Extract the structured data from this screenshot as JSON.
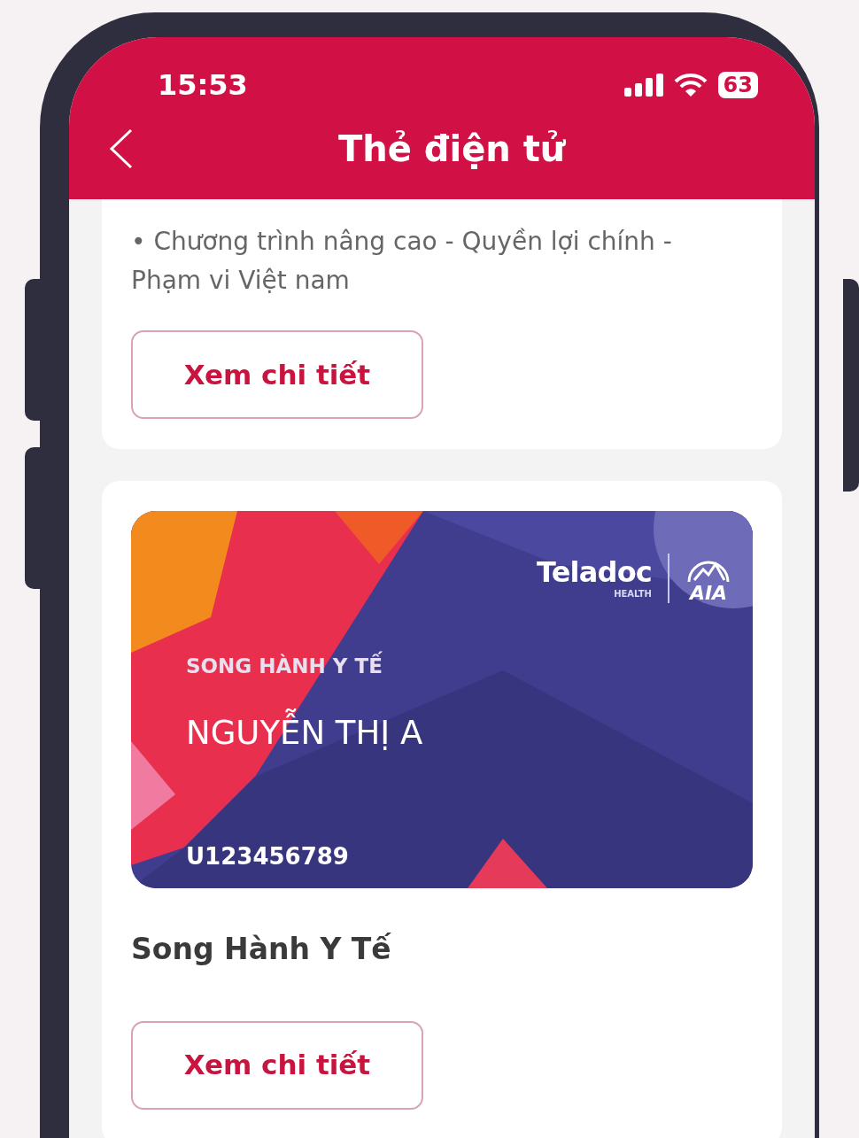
{
  "status_bar": {
    "time": "15:53",
    "battery": "63"
  },
  "header": {
    "title": "Thẻ điện tử"
  },
  "cards": [
    {
      "kind": "text",
      "description": "• Chương trình nâng cao - Quyền lợi chính - Phạm vi Việt nam",
      "button": "Xem chi tiết"
    },
    {
      "kind": "member",
      "brand": "Teladoc",
      "brand_sub": "HEALTH",
      "partner": "AIA",
      "program": "SONG HÀNH Y TẾ",
      "name": "NGUYỄN THỊ A",
      "member_id": "U123456789",
      "title": "Song Hành Y Tế",
      "button": "Xem chi tiết"
    }
  ]
}
